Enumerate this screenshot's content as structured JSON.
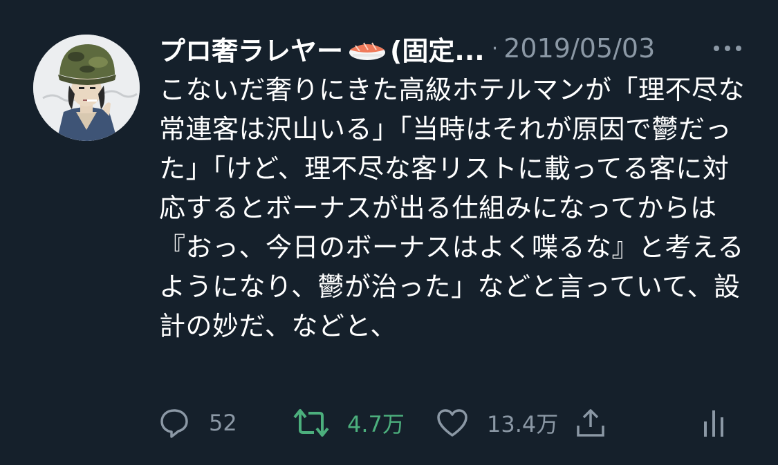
{
  "tweet": {
    "display_name": "プロ奢ラレヤー",
    "name_suffix": "(固定...",
    "separator": "·",
    "timestamp": "2019/05/03",
    "text": "こないだ奢りにきた高級ホテルマンが「理不尽な常連客は沢山いる」「当時はそれが原因で鬱だった」「けど、理不尽な客リストに載ってる客に対応するとボーナスが出る仕組みになってからは『おっ、今日のボーナスはよく喋るな』と考えるようになり、鬱が治った」などと言っていて、設計の妙だ、などと、"
  },
  "actions": {
    "replies": "52",
    "retweets": "4.7万",
    "likes": "13.4万"
  },
  "colors": {
    "background": "#15202b",
    "text": "#ffffff",
    "secondary": "#8b98a5",
    "retweet_active": "#4caf7d"
  },
  "icons": {
    "avatar": "avatar",
    "name_emoji": "sushi-icon",
    "more": "more-icon",
    "reply": "reply-icon",
    "retweet": "retweet-icon",
    "like": "heart-icon",
    "share": "share-icon",
    "stats": "stats-icon"
  }
}
